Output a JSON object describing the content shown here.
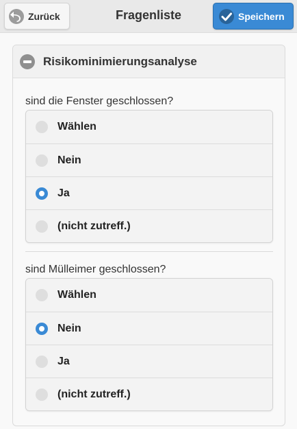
{
  "header": {
    "back_label": "Zurück",
    "title": "Fragenliste",
    "save_label": "Speichern"
  },
  "section": {
    "title": "Risikominimierungsanalyse"
  },
  "questions": [
    {
      "text": "sind die Fenster geschlossen?",
      "options": [
        {
          "label": "Wählen",
          "selected": false
        },
        {
          "label": "Nein",
          "selected": false
        },
        {
          "label": "Ja",
          "selected": true
        },
        {
          "label": "(nicht zutreff.)",
          "selected": false
        }
      ]
    },
    {
      "text": "sind Mülleimer geschlossen?",
      "options": [
        {
          "label": "Wählen",
          "selected": false
        },
        {
          "label": "Nein",
          "selected": true
        },
        {
          "label": "Ja",
          "selected": false
        },
        {
          "label": "(nicht zutreff.)",
          "selected": false
        }
      ]
    }
  ],
  "colors": {
    "accent": "#3a8ad5",
    "header_bg": "#e9e9e9"
  },
  "icons": {
    "back": "arrow-back-icon",
    "save": "check-icon",
    "section": "minus-circle-icon"
  }
}
